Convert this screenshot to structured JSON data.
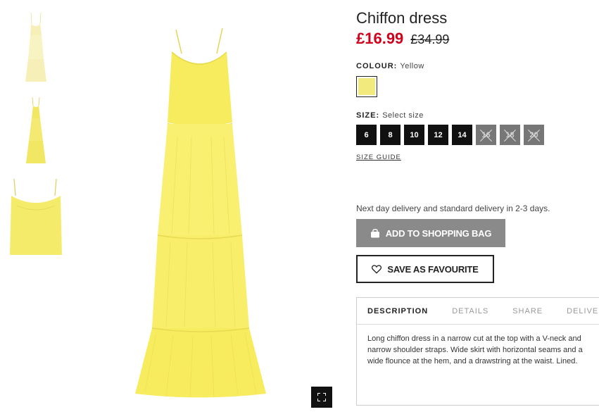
{
  "product": {
    "title": "Chiffon dress",
    "price_now": "£16.99",
    "price_old": "£34.99"
  },
  "colour": {
    "label": "COLOUR:",
    "value": "Yellow",
    "swatch_color": "#f2ea7c"
  },
  "size": {
    "label": "SIZE:",
    "value": "Select size",
    "options": [
      {
        "label": "6",
        "available": true
      },
      {
        "label": "8",
        "available": true
      },
      {
        "label": "10",
        "available": true
      },
      {
        "label": "12",
        "available": true
      },
      {
        "label": "14",
        "available": true
      },
      {
        "label": "16",
        "available": false
      },
      {
        "label": "18",
        "available": false
      },
      {
        "label": "20",
        "available": false
      }
    ],
    "guide_label": "SIZE GUIDE"
  },
  "delivery_text": "Next day delivery and standard delivery in 2-3 days.",
  "buttons": {
    "add_to_bag": "ADD TO SHOPPING BAG",
    "add_to_bag_icon": "shopping-bag-icon",
    "favourite": "SAVE AS FAVOURITE",
    "favourite_icon": "heart-icon",
    "expand_icon": "fullscreen-icon"
  },
  "tabs": {
    "items": [
      "DESCRIPTION",
      "DETAILS",
      "SHARE",
      "DELIVERY"
    ],
    "active": 0,
    "description": "Long chiffon dress in a narrow cut at the top with a V-neck and narrow shoulder straps. Wide skirt with horizontal seams and a wide flounce at the hem, and a drawstring at the waist. Lined."
  },
  "colors": {
    "sale": "#d0021b",
    "dress": "#f7ec5e"
  }
}
